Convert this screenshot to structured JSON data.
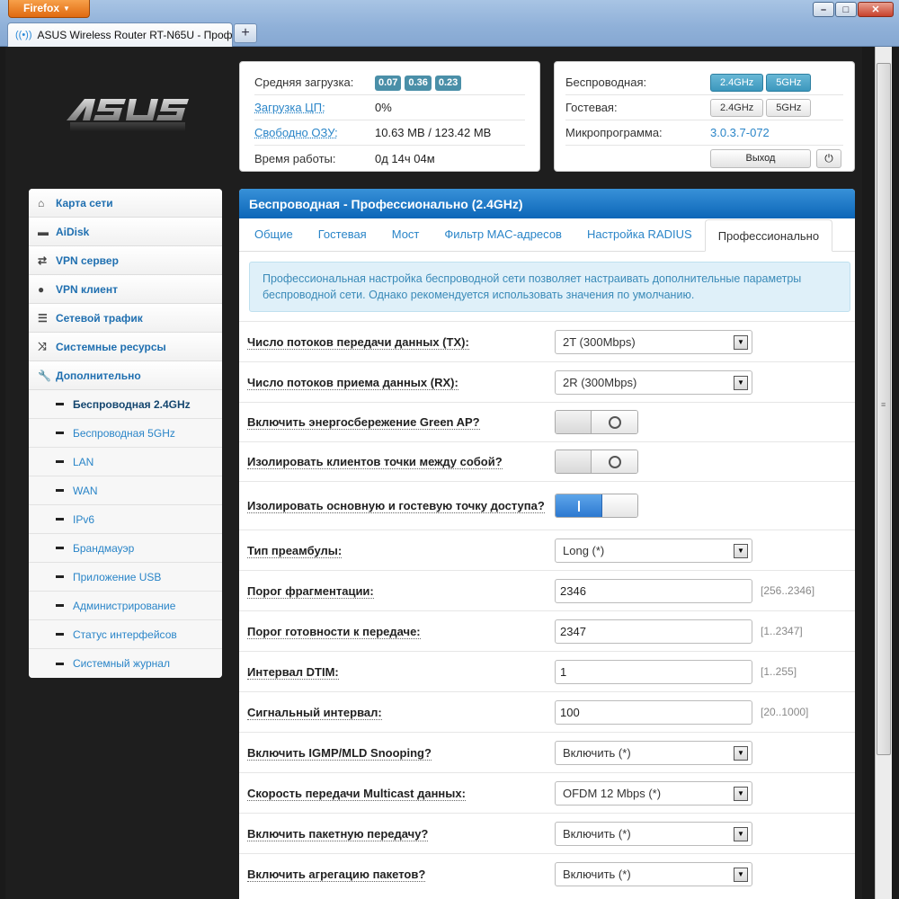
{
  "browser": {
    "app_button": "Firefox",
    "tab_title": "ASUS Wireless Router RT-N65U - Профе...",
    "new_tab": "+"
  },
  "status_left": {
    "load_label": "Средняя загрузка:",
    "load_values": [
      "0.07",
      "0.36",
      "0.23"
    ],
    "cpu_label": "Загрузка ЦП:",
    "cpu_value": "0%",
    "ram_label": "Свободно ОЗУ:",
    "ram_value": "10.63 MB / 123.42 MB",
    "uptime_label": "Время работы:",
    "uptime_value": "0д 14ч 04м"
  },
  "status_right": {
    "wireless_label": "Беспроводная:",
    "guest_label": "Гостевая:",
    "firmware_label": "Микропрограмма:",
    "firmware_value": "3.0.3.7-072",
    "band_24": "2.4GHz",
    "band_5": "5GHz",
    "exit_button": "Выход"
  },
  "sidebar": {
    "items": [
      {
        "label": "Карта сети",
        "icon": "home-icon"
      },
      {
        "label": "AiDisk",
        "icon": "disk-icon"
      },
      {
        "label": "VPN сервер",
        "icon": "sync-icon"
      },
      {
        "label": "VPN клиент",
        "icon": "globe-icon"
      },
      {
        "label": "Сетевой трафик",
        "icon": "list-icon"
      },
      {
        "label": "Системные ресурсы",
        "icon": "shuffle-icon"
      },
      {
        "label": "Дополнительно",
        "icon": "wrench-icon"
      }
    ],
    "subitems": [
      "Беспроводная 2.4GHz",
      "Беспроводная 5GHz",
      "LAN",
      "WAN",
      "IPv6",
      "Брандмауэр",
      "Приложение USB",
      "Администрирование",
      "Статус интерфейсов",
      "Системный журнал"
    ]
  },
  "main": {
    "title": "Беспроводная - Профессионально (2.4GHz)",
    "tabs": [
      "Общие",
      "Гостевая",
      "Мост",
      "Фильтр MAC-адресов",
      "Настройка RADIUS",
      "Профессионально"
    ],
    "info": "Профессиональная настройка беспроводной сети позволяет настраивать дополнительные параметры беспроводной сети. Однако рекомендуется использовать значения по умолчанию.",
    "fields": {
      "tx_label": "Число потоков передачи данных (TX):",
      "tx_value": "2T (300Mbps)",
      "rx_label": "Число потоков приема данных (RX):",
      "rx_value": "2R (300Mbps)",
      "greenap_label": "Включить энергосбережение Green AP?",
      "isolate_label": "Изолировать клиентов точки между собой?",
      "isolate_guest_label": "Изолировать основную и гостевую точку доступа?",
      "preamble_label": "Тип преамбулы:",
      "preamble_value": "Long (*)",
      "frag_label": "Порог фрагментации:",
      "frag_value": "2346",
      "frag_hint": "[256..2346]",
      "rts_label": "Порог готовности к передаче:",
      "rts_value": "2347",
      "rts_hint": "[1..2347]",
      "dtim_label": "Интервал DTIM:",
      "dtim_value": "1",
      "dtim_hint": "[1..255]",
      "beacon_label": "Сигнальный интервал:",
      "beacon_value": "100",
      "beacon_hint": "[20..1000]",
      "igmp_label": "Включить IGMP/MLD Snooping?",
      "igmp_value": "Включить (*)",
      "mcast_label": "Скорость передачи Multicast данных:",
      "mcast_value": "OFDM 12 Mbps (*)",
      "burst_label": "Включить пакетную передачу?",
      "burst_value": "Включить (*)",
      "aggr_label": "Включить агрегацию пакетов?",
      "aggr_value": "Включить (*)"
    }
  }
}
